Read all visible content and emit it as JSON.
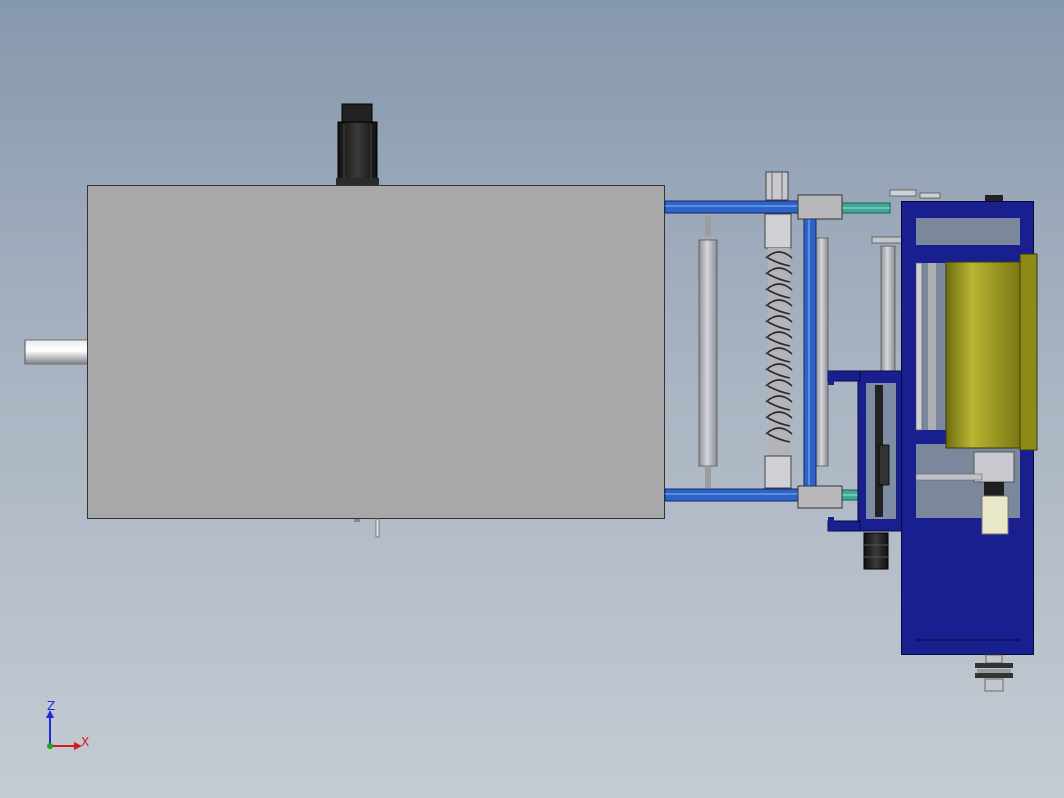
{
  "viewport": {
    "background_top": "#8698ae",
    "background_bottom": "#c4cbd3"
  },
  "model": {
    "components": [
      "shaft-stub",
      "main-housing",
      "top-motor",
      "guide-rods",
      "helical-spring",
      "slider-blocks",
      "drive-frame",
      "gearbox-cylinder",
      "bottom-pulley",
      "side-motor"
    ],
    "colors": {
      "housing": "#a8a8a8",
      "frame_blue": "#1a1f8f",
      "rail_blue": "#2e64c8",
      "motor_black": "#1b1b1b",
      "cylinder_olive": "#a4a21e",
      "rod_grey": "#c0c2c8"
    }
  },
  "triad": {
    "z_label": "Z",
    "x_label": "X",
    "z_color": "#1c2bd6",
    "x_color": "#d41c1c",
    "y_color": "#18a818"
  }
}
